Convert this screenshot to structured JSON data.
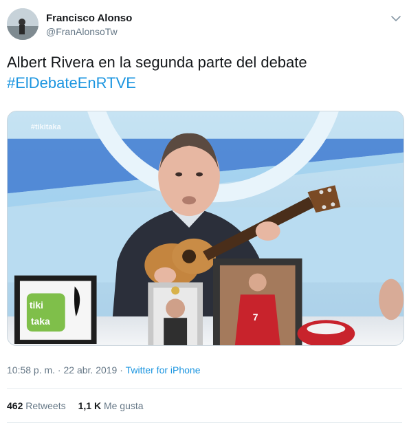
{
  "author": {
    "name": "Francisco Alonso",
    "handle": "@FranAlonsoTw",
    "avatar_icon": "user-avatar"
  },
  "menu_icon": "chevron-down-icon",
  "tweet": {
    "text": "Albert Rivera en la segunda parte del debate",
    "hashtag": "#ElDebateEnRTVE"
  },
  "media": {
    "watermark": "#tikitaka",
    "sticker_line1": "tiki",
    "sticker_line2": "taka",
    "jersey_number": "7"
  },
  "meta": {
    "time": "10:58 p. m.",
    "separator": " · ",
    "date": "22 abr. 2019",
    "source": "Twitter for iPhone"
  },
  "stats": {
    "retweets_count": "462",
    "retweets_label": "Retweets",
    "likes_count": "1,1 K",
    "likes_label": "Me gusta"
  },
  "colors": {
    "link": "#1b95e0",
    "secondary_text": "#657786",
    "divider": "#e6ecf0"
  }
}
